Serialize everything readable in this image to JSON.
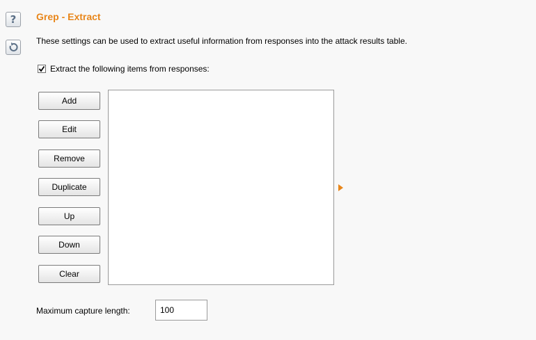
{
  "panel": {
    "title": "Grep - Extract",
    "description": "These settings can be used to extract useful information from responses into the attack results table.",
    "help_icon": "help-question-icon",
    "restore_icon": "restore-defaults-icon",
    "accent_color": "#e8861a"
  },
  "extract": {
    "checkbox_label": "Extract the following items from responses:",
    "checked": true
  },
  "buttons": {
    "add": "Add",
    "edit": "Edit",
    "remove": "Remove",
    "duplicate": "Duplicate",
    "up": "Up",
    "down": "Down",
    "clear": "Clear"
  },
  "items_list": [],
  "capture": {
    "label": "Maximum capture length:",
    "value": "100"
  }
}
